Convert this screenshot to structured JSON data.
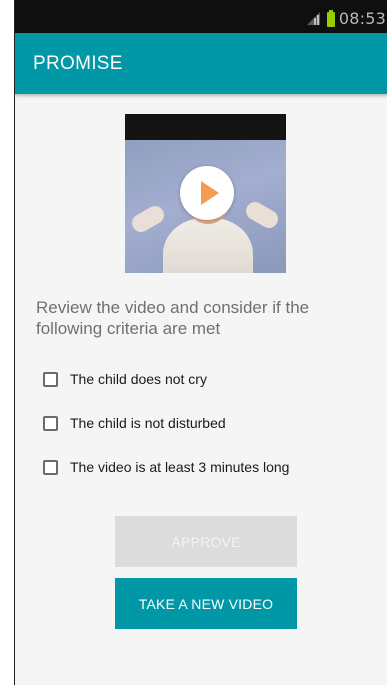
{
  "status_bar": {
    "time": "08:53"
  },
  "app_bar": {
    "title": "PROMISE"
  },
  "video": {
    "playing": false
  },
  "instructions": "Review the video and consider if the following criteria are met",
  "criteria": [
    {
      "label": "The child does not cry",
      "checked": false
    },
    {
      "label": "The child is not disturbed",
      "checked": false
    },
    {
      "label": "The video is at least 3 minutes long",
      "checked": false
    }
  ],
  "buttons": {
    "approve": {
      "label": "APPROVE",
      "enabled": false
    },
    "new_video": {
      "label": "TAKE A NEW VIDEO",
      "enabled": true
    }
  },
  "colors": {
    "primary": "#0097a7",
    "status_bar": "#0f0f0f",
    "battery": "#99cc00",
    "disabled_button": "#dcdcdc"
  }
}
